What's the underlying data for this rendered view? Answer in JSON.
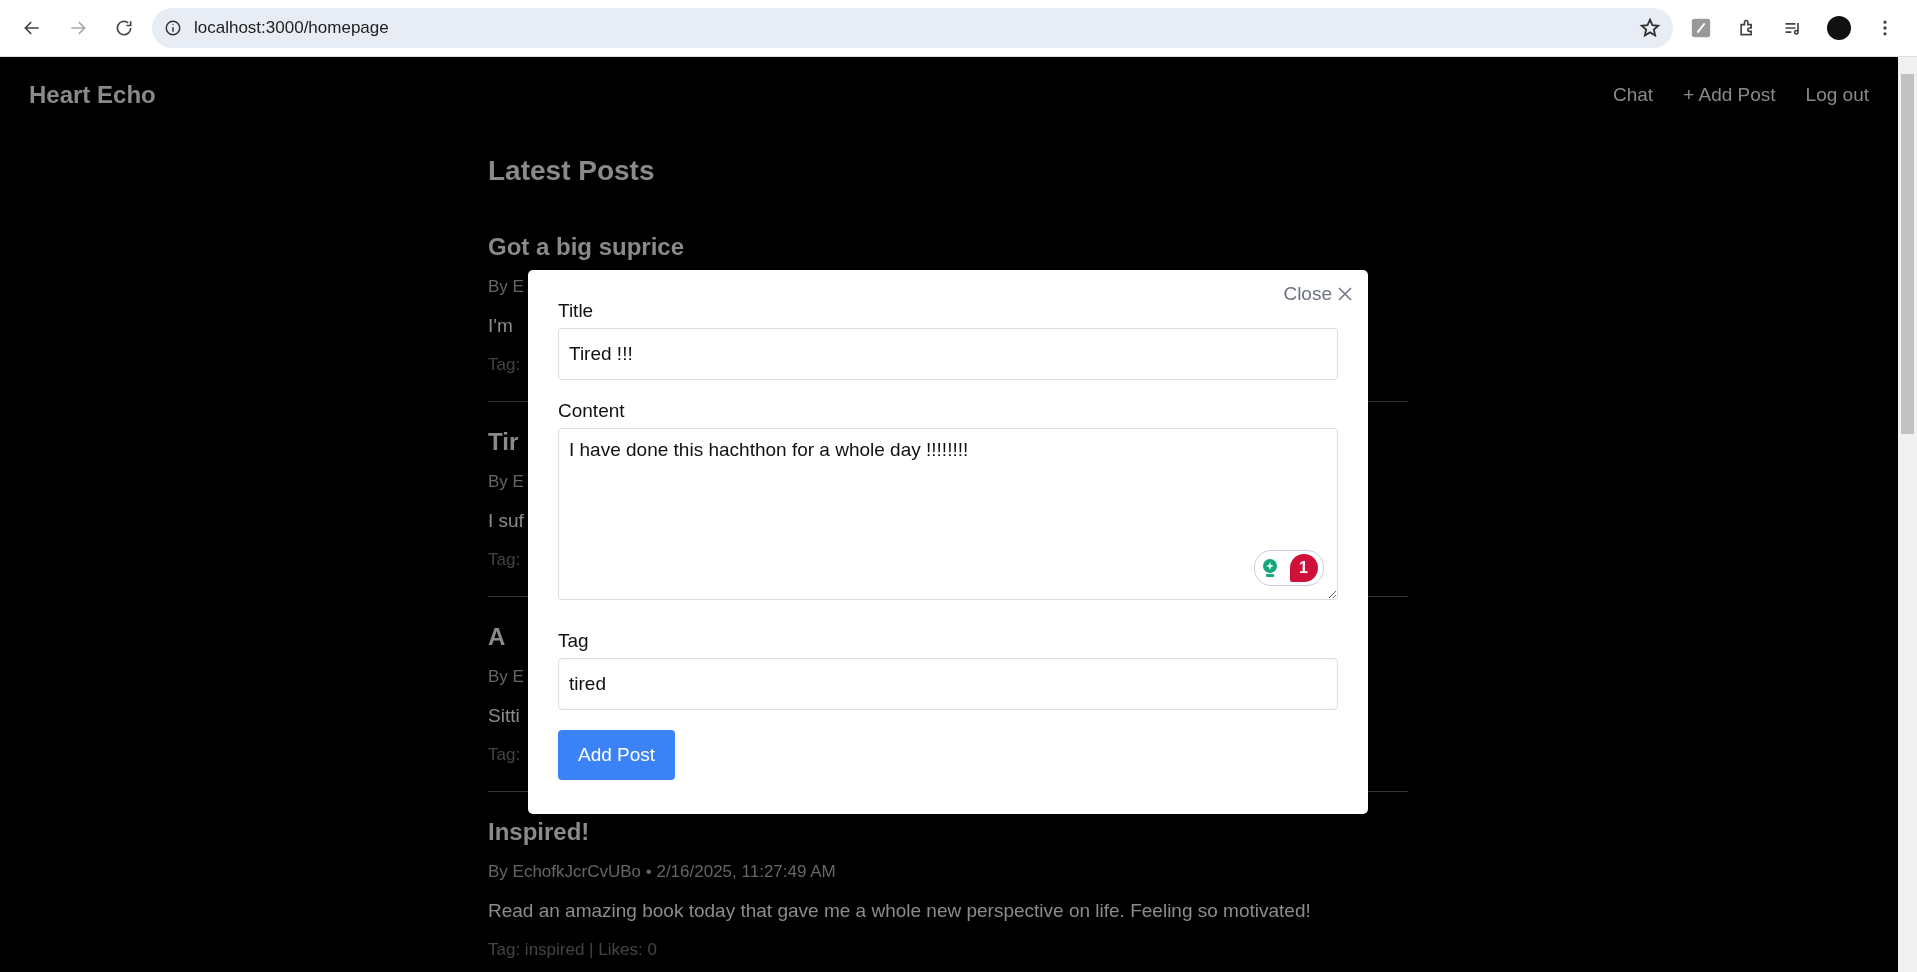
{
  "browser": {
    "url": "localhost:3000/homepage"
  },
  "navbar": {
    "brand": "Heart Echo",
    "links": [
      "Chat",
      "+ Add Post",
      "Log out"
    ]
  },
  "feed": {
    "heading": "Latest Posts",
    "posts": [
      {
        "title": "Got a big suprice",
        "meta": "By E",
        "body": "I'm",
        "footer": "Tag:"
      },
      {
        "title": "Tir",
        "meta": "By E",
        "body": "I suf",
        "footer": "Tag:"
      },
      {
        "title": "A",
        "meta": "By E",
        "body": "Sitti",
        "footer": "Tag:"
      },
      {
        "title": "Inspired!",
        "meta": "By EchofkJcrCvUBo • 2/16/2025, 11:27:49 AM",
        "body": "Read an amazing book today that gave me a whole new perspective on life. Feeling so motivated!",
        "footer": "Tag: inspired | Likes: 0"
      }
    ]
  },
  "modal": {
    "close": "Close",
    "fields": [
      {
        "kind": "input",
        "label": "Title",
        "value": "Tired !!!"
      },
      {
        "kind": "textarea",
        "label": "Content",
        "value": "I have done this hachthon for a whole day !!!!!!!!",
        "badge": "1"
      },
      {
        "kind": "input",
        "label": "Tag",
        "value": "tired"
      }
    ],
    "submit": "Add Post"
  }
}
